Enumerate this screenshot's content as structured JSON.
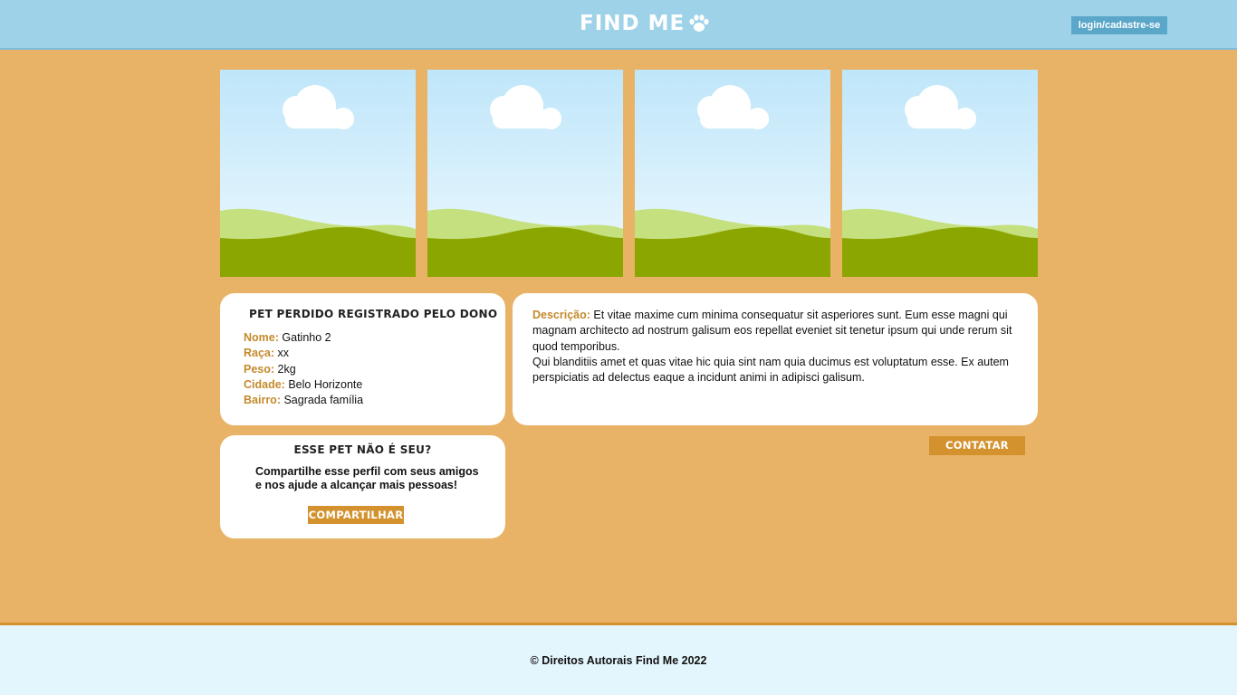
{
  "header": {
    "logo_text": "FIND ME",
    "logo_icon": "paw-icon",
    "login_label": "login/cadastre-se"
  },
  "gallery": {
    "images": [
      {
        "icon": "image-placeholder-icon"
      },
      {
        "icon": "image-placeholder-icon"
      },
      {
        "icon": "image-placeholder-icon"
      },
      {
        "icon": "image-placeholder-icon"
      }
    ]
  },
  "info_card": {
    "title": "PET PERDIDO REGISTRADO PELO DONO",
    "fields": [
      {
        "label": "Nome:",
        "value": "Gatinho 2"
      },
      {
        "label": "Raça:",
        "value": "xx"
      },
      {
        "label": "Peso:",
        "value": "2kg"
      },
      {
        "label": "Cidade:",
        "value": "Belo Horizonte"
      },
      {
        "label": "Bairro:",
        "value": "Sagrada família"
      }
    ]
  },
  "description_card": {
    "label": "Descrição:",
    "paragraph_1": "Et vitae maxime cum minima consequatur sit asperiores sunt. Eum esse magni qui magnam architecto ad nostrum galisum eos repellat eveniet sit tenetur ipsum qui unde rerum sit quod temporibus.",
    "paragraph_2": "Qui blanditiis amet et quas vitae hic quia sint nam quia ducimus est voluptatum esse. Ex autem perspiciatis ad delectus eaque a incidunt animi in adipisci galisum."
  },
  "share_card": {
    "title": "ESSE PET NÃO É SEU?",
    "line_1": "Compartilhe esse perfil com seus amigos",
    "line_2": "e nos ajude a alcançar mais pessoas!",
    "button_label": "COMPARTILHAR"
  },
  "contact_button_label": "CONTATAR",
  "footer": {
    "copyright_symbol": "©",
    "text": "Direitos Autorais Find Me 2022"
  },
  "colors": {
    "background": "#e8b366",
    "header": "#9ed2e8",
    "accent": "#d4922e",
    "label": "#c48a2c",
    "footer": "#e4f6fd"
  }
}
